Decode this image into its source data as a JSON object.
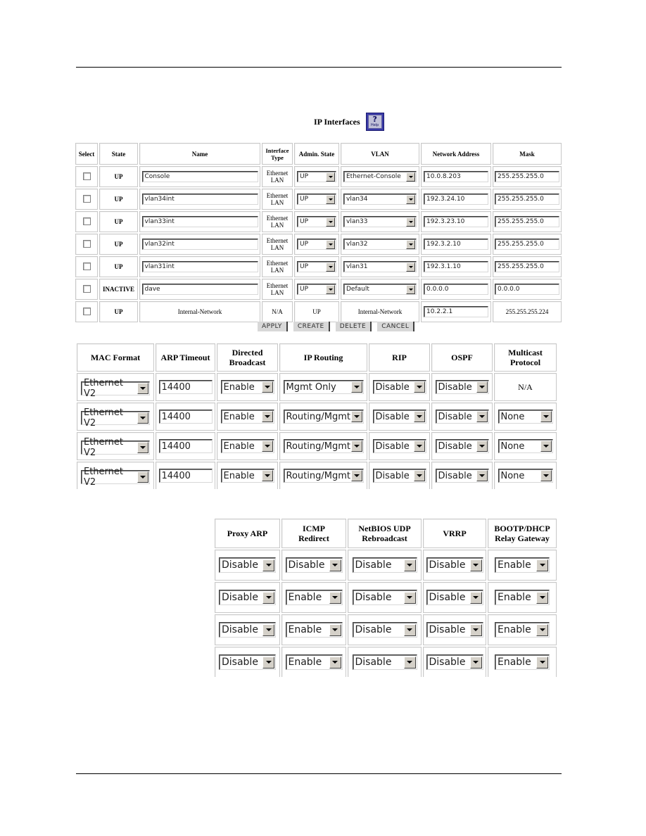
{
  "page": {
    "title": "IP Interfaces",
    "help_icon_label": "Help"
  },
  "interfaces_table": {
    "headers": {
      "select": "Select",
      "state": "State",
      "name": "Name",
      "interface_type": "Interface Type",
      "admin_state": "Admin. State",
      "vlan": "VLAN",
      "network_address": "Network Address",
      "mask": "Mask"
    },
    "rows": [
      {
        "state": "UP",
        "name": "Console",
        "type_line1": "Ethernet",
        "type_line2": "LAN",
        "admin_state": "UP",
        "vlan": "Ethernet-Console",
        "network_address": "10.0.8.203",
        "mask": "255.255.255.0"
      },
      {
        "state": "UP",
        "name": "vlan34int",
        "type_line1": "Ethernet",
        "type_line2": "LAN",
        "admin_state": "UP",
        "vlan": "vlan34",
        "network_address": "192.3.24.10",
        "mask": "255.255.255.0"
      },
      {
        "state": "UP",
        "name": "vlan33int",
        "type_line1": "Ethernet",
        "type_line2": "LAN",
        "admin_state": "UP",
        "vlan": "vlan33",
        "network_address": "192.3.23.10",
        "mask": "255.255.255.0"
      },
      {
        "state": "UP",
        "name": "vlan32int",
        "type_line1": "Ethernet",
        "type_line2": "LAN",
        "admin_state": "UP",
        "vlan": "vlan32",
        "network_address": "192.3.2.10",
        "mask": "255.255.255.0"
      },
      {
        "state": "UP",
        "name": "vlan31int",
        "type_line1": "Ethernet",
        "type_line2": "LAN",
        "admin_state": "UP",
        "vlan": "vlan31",
        "network_address": "192.3.1.10",
        "mask": "255.255.255.0"
      },
      {
        "state": "INACTIVE",
        "name": "dave",
        "type_line1": "Ethernet",
        "type_line2": "LAN",
        "admin_state": "UP",
        "vlan": "Default",
        "network_address": "0.0.0.0",
        "mask": "0.0.0.0"
      },
      {
        "state": "UP",
        "name": "Internal-Network",
        "type": "N/A",
        "admin_state": "UP",
        "vlan": "Internal-Network",
        "network_address": "10.2.2.1",
        "mask": "255.255.255.224"
      }
    ]
  },
  "actions": {
    "apply": "APPLY",
    "create": "CREATE",
    "delete": "DELETE",
    "cancel": "CANCEL"
  },
  "protocol_table": {
    "headers": {
      "mac_format": "MAC Format",
      "arp_timeout": "ARP Timeout",
      "directed_broadcast_1": "Directed",
      "directed_broadcast_2": "Broadcast",
      "ip_routing": "IP Routing",
      "rip": "RIP",
      "ospf": "OSPF",
      "multicast_1": "Multicast",
      "multicast_2": "Protocol"
    },
    "rows": [
      {
        "mac_format": "Ethernet V2",
        "arp_timeout": "14400",
        "directed_broadcast": "Enable",
        "ip_routing": "Mgmt Only",
        "rip": "Disable",
        "ospf": "Disable",
        "multicast": "N/A"
      },
      {
        "mac_format": "Ethernet V2",
        "arp_timeout": "14400",
        "directed_broadcast": "Enable",
        "ip_routing": "Routing/Mgmt",
        "rip": "Disable",
        "ospf": "Disable",
        "multicast": "None"
      },
      {
        "mac_format": "Ethernet V2",
        "arp_timeout": "14400",
        "directed_broadcast": "Enable",
        "ip_routing": "Routing/Mgmt",
        "rip": "Disable",
        "ospf": "Disable",
        "multicast": "None"
      },
      {
        "mac_format": "Ethernet V2",
        "arp_timeout": "14400",
        "directed_broadcast": "Enable",
        "ip_routing": "Routing/Mgmt",
        "rip": "Disable",
        "ospf": "Disable",
        "multicast": "None"
      }
    ]
  },
  "services_table": {
    "headers": {
      "proxy_arp": "Proxy ARP",
      "icmp_1": "ICMP",
      "icmp_2": "Redirect",
      "netbios_1": "NetBIOS UDP",
      "netbios_2": "Rebroadcast",
      "vrrp": "VRRP",
      "bootp_1": "BOOTP/DHCP",
      "bootp_2": "Relay Gateway"
    },
    "rows": [
      {
        "proxy_arp": "Disable",
        "icmp_redirect": "Disable",
        "netbios": "Disable",
        "vrrp": "Disable",
        "bootp": "Enable"
      },
      {
        "proxy_arp": "Disable",
        "icmp_redirect": "Enable",
        "netbios": "Disable",
        "vrrp": "Disable",
        "bootp": "Enable"
      },
      {
        "proxy_arp": "Disable",
        "icmp_redirect": "Enable",
        "netbios": "Disable",
        "vrrp": "Disable",
        "bootp": "Enable"
      },
      {
        "proxy_arp": "Disable",
        "icmp_redirect": "Enable",
        "netbios": "Disable",
        "vrrp": "Disable",
        "bootp": "Enable"
      }
    ]
  }
}
